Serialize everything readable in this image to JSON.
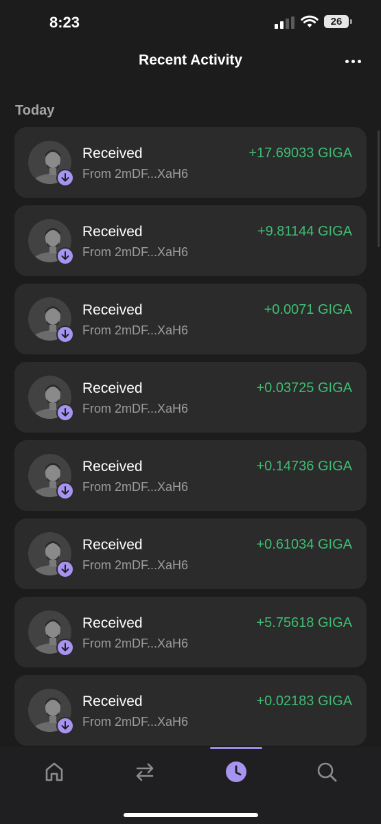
{
  "status_bar": {
    "time": "8:23",
    "battery": "26"
  },
  "header": {
    "title": "Recent Activity"
  },
  "section": {
    "label": "Today"
  },
  "colors": {
    "background": "#1c1c1c",
    "card": "#2b2b2b",
    "positive": "#3fbd73",
    "accent": "#a794f0"
  },
  "activities": [
    {
      "title": "Received",
      "from": "From 2mDF...XaH6",
      "amount": "+17.69033 GIGA",
      "icon": "receive-arrow-icon"
    },
    {
      "title": "Received",
      "from": "From 2mDF...XaH6",
      "amount": "+9.81144 GIGA",
      "icon": "receive-arrow-icon"
    },
    {
      "title": "Received",
      "from": "From 2mDF...XaH6",
      "amount": "+0.0071 GIGA",
      "icon": "receive-arrow-icon"
    },
    {
      "title": "Received",
      "from": "From 2mDF...XaH6",
      "amount": "+0.03725 GIGA",
      "icon": "receive-arrow-icon"
    },
    {
      "title": "Received",
      "from": "From 2mDF...XaH6",
      "amount": "+0.14736 GIGA",
      "icon": "receive-arrow-icon"
    },
    {
      "title": "Received",
      "from": "From 2mDF...XaH6",
      "amount": "+0.61034 GIGA",
      "icon": "receive-arrow-icon"
    },
    {
      "title": "Received",
      "from": "From 2mDF...XaH6",
      "amount": "+5.75618 GIGA",
      "icon": "receive-arrow-icon"
    },
    {
      "title": "Received",
      "from": "From 2mDF...XaH6",
      "amount": "+0.02183 GIGA",
      "icon": "receive-arrow-icon"
    }
  ],
  "nav": [
    {
      "icon": "home-icon"
    },
    {
      "icon": "swap-icon"
    },
    {
      "icon": "clock-icon",
      "active": true
    },
    {
      "icon": "search-icon"
    }
  ]
}
